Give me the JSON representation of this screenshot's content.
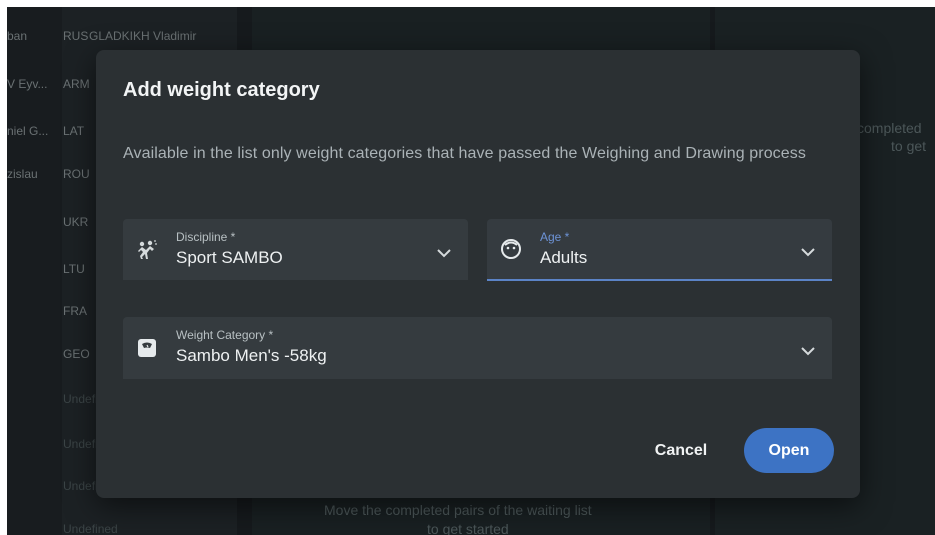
{
  "background": {
    "names": [
      "ban",
      "V Eyv...",
      "niel G...",
      "zislau"
    ],
    "countries": [
      "RUS",
      "ARM",
      "LAT",
      "ROU",
      "UKR",
      "LTU",
      "FRA",
      "GEO",
      "Undefi",
      "Undefi",
      "Undefi",
      "Undefined"
    ],
    "first_athlete": "GLADKIKH Vladimir",
    "right_text_line1": "completed",
    "right_text_line2": "to get",
    "middle_text_line1": "Move the completed pairs of the waiting list",
    "middle_text_line2": "to get started"
  },
  "modal": {
    "title": "Add weight category",
    "description": "Available in the list only weight categories that have passed the Weighing and Drawing process",
    "discipline": {
      "label": "Discipline *",
      "value": "Sport SAMBO",
      "icon": "wrestlers-icon"
    },
    "age": {
      "label": "Age *",
      "value": "Adults",
      "icon": "face-icon"
    },
    "weight_category": {
      "label": "Weight Category *",
      "value": "Sambo Men's -58kg",
      "icon": "weight-scale-icon"
    },
    "cancel_label": "Cancel",
    "open_label": "Open"
  },
  "colors": {
    "modal_bg": "#2b3033",
    "field_bg": "#353b3f",
    "accent": "#3d73c4",
    "focus_underline": "#5b83c7"
  }
}
